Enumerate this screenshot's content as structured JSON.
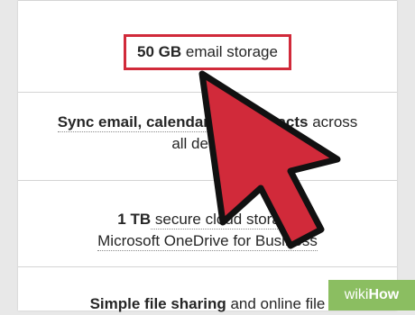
{
  "features": [
    {
      "bold": "50 GB",
      "rest": " email storage"
    },
    {
      "line1_bold": "Sync email, calendar",
      "line1_hidden": " and contacts",
      "line1_rest": " across",
      "line2": "all devices"
    },
    {
      "line1_bold": "1 TB",
      "line1_rest": " secure cloud storage",
      "line2": "Microsoft OneDrive for Business"
    },
    {
      "line1_bold": "Simple file sharing",
      "line1_rest": " and online file"
    }
  ],
  "cursor": {
    "icon": "arrow-cursor-icon",
    "fill": "#d12a3a",
    "outline": "#111111"
  },
  "highlight_color": "#d12a3a",
  "watermark": {
    "prefix": "wiki",
    "suffix": "How"
  }
}
